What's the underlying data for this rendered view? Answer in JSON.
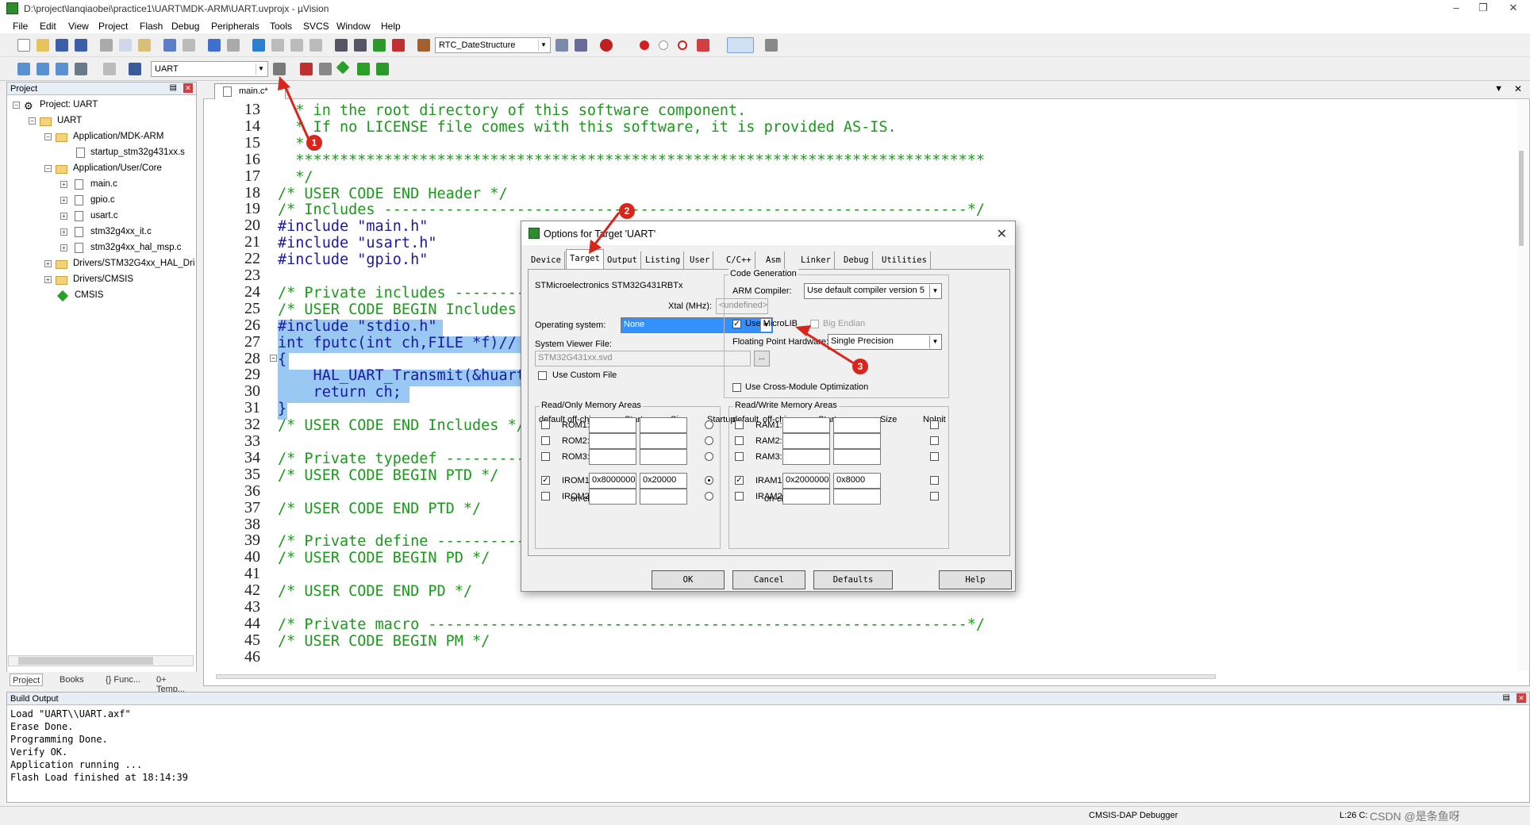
{
  "window": {
    "title": "D:\\project\\lanqiaobei\\practice1\\UART\\MDK-ARM\\UART.uvprojx - µVision"
  },
  "menu": [
    "File",
    "Edit",
    "View",
    "Project",
    "Flash",
    "Debug",
    "Peripherals",
    "Tools",
    "SVCS",
    "Window",
    "Help"
  ],
  "toolbar": {
    "function_combo": "RTC_DateStructure",
    "target_combo": "UART"
  },
  "project_panel": {
    "title": "Project",
    "tree": [
      "Project: UART",
      "UART",
      "Application/MDK-ARM",
      "startup_stm32g431xx.s",
      "Application/User/Core",
      "main.c",
      "gpio.c",
      "usart.c",
      "stm32g4xx_it.c",
      "stm32g4xx_hal_msp.c",
      "Drivers/STM32G4xx_HAL_Dri",
      "Drivers/CMSIS",
      "CMSIS"
    ],
    "tabs": [
      "Project",
      "Books",
      "{} Func...",
      "0+ Temp..."
    ]
  },
  "editor": {
    "tab": "main.c*",
    "lines": [
      {
        "n": "13",
        "t": "  * in the root directory of this software component."
      },
      {
        "n": "14",
        "t": "  * If no LICENSE file comes with this software, it is provided AS-IS."
      },
      {
        "n": "15",
        "t": "  *"
      },
      {
        "n": "16",
        "t": "  ******************************************************************************"
      },
      {
        "n": "17",
        "t": "  */"
      },
      {
        "n": "18",
        "t": "/* USER CODE END Header */"
      },
      {
        "n": "19",
        "t": "/* Includes ------------------------------------------------------------------*/"
      },
      {
        "n": "20",
        "t": "#include \"main.h\""
      },
      {
        "n": "21",
        "t": "#include \"usart.h\""
      },
      {
        "n": "22",
        "t": "#include \"gpio.h\""
      },
      {
        "n": "23",
        "t": ""
      },
      {
        "n": "24",
        "t": "/* Private includes ----------"
      },
      {
        "n": "25",
        "t": "/* USER CODE BEGIN Includes"
      },
      {
        "n": "26",
        "t": "#include \"stdio.h\""
      },
      {
        "n": "27",
        "t": "int fputc(int ch,FILE *f)//"
      },
      {
        "n": "28",
        "t": "{"
      },
      {
        "n": "29",
        "t": "    HAL_UART_Transmit(&huart"
      },
      {
        "n": "30",
        "t": "    return ch;"
      },
      {
        "n": "31",
        "t": "}"
      },
      {
        "n": "32",
        "t": "/* USER CODE END Includes */"
      },
      {
        "n": "33",
        "t": ""
      },
      {
        "n": "34",
        "t": "/* Private typedef ----------"
      },
      {
        "n": "35",
        "t": "/* USER CODE BEGIN PTD */"
      },
      {
        "n": "36",
        "t": ""
      },
      {
        "n": "37",
        "t": "/* USER CODE END PTD */"
      },
      {
        "n": "38",
        "t": ""
      },
      {
        "n": "39",
        "t": "/* Private define -----------"
      },
      {
        "n": "40",
        "t": "/* USER CODE BEGIN PD */"
      },
      {
        "n": "41",
        "t": ""
      },
      {
        "n": "42",
        "t": "/* USER CODE END PD */"
      },
      {
        "n": "43",
        "t": ""
      },
      {
        "n": "44",
        "t": "/* Private macro -------------------------------------------------------------*/"
      },
      {
        "n": "45",
        "t": "/* USER CODE BEGIN PM */"
      },
      {
        "n": "46",
        "t": ""
      }
    ]
  },
  "dialog": {
    "title": "Options for Target 'UART'",
    "tabs": [
      "Device",
      "Target",
      "Output",
      "Listing",
      "User",
      "C/C++",
      "Asm",
      "Linker",
      "Debug",
      "Utilities"
    ],
    "active_tab": "Target",
    "device": "STMicroelectronics STM32G431RBTx",
    "xtal_label": "Xtal (MHz):",
    "xtal_value": "<undefined>",
    "os_label": "Operating system:",
    "os_value": "None",
    "svd_label": "System Viewer File:",
    "svd_value": "STM32G431xx.svd",
    "custom_file": "Use Custom File",
    "codegen_title": "Code Generation",
    "compiler_label": "ARM Compiler:",
    "compiler_value": "Use default compiler version 5",
    "microlib": "Use MicroLIB",
    "big_endian": "Big Endian",
    "fp_label": "Floating Point Hardware:",
    "fp_value": "Single Precision",
    "cross_module": "Use Cross-Module Optimization",
    "ro_title": "Read/Only Memory Areas",
    "rw_title": "Read/Write Memory Areas",
    "col_default": "default",
    "col_offchip": "off-chip",
    "col_start": "Start",
    "col_size": "Size",
    "col_startup": "Startup",
    "col_noinit": "NoInit",
    "onchip": "on-chip",
    "rom_rows": [
      {
        "name": "ROM1:",
        "start": "",
        "size": ""
      },
      {
        "name": "ROM2:",
        "start": "",
        "size": ""
      },
      {
        "name": "ROM3:",
        "start": "",
        "size": ""
      },
      {
        "name": "IROM1:",
        "start": "0x8000000",
        "size": "0x20000"
      },
      {
        "name": "IROM2:",
        "start": "",
        "size": ""
      }
    ],
    "ram_rows": [
      {
        "name": "RAM1:",
        "start": "",
        "size": ""
      },
      {
        "name": "RAM2:",
        "start": "",
        "size": ""
      },
      {
        "name": "RAM3:",
        "start": "",
        "size": ""
      },
      {
        "name": "IRAM1:",
        "start": "0x20000000",
        "size": "0x8000"
      },
      {
        "name": "IRAM2:",
        "start": "",
        "size": ""
      }
    ],
    "buttons": [
      "OK",
      "Cancel",
      "Defaults",
      "Help"
    ]
  },
  "annotations": [
    "1",
    "2",
    "3"
  ],
  "build_output": {
    "title": "Build Output",
    "lines": [
      "Load \"UART\\\\UART.axf\"",
      "Erase Done.",
      "Programming Done.",
      "Verify OK.",
      "Application running ...",
      "Flash Load finished at 18:14:39"
    ]
  },
  "status": {
    "debugger": "CMSIS-DAP Debugger",
    "position": "L:26 C:",
    "watermark": "CSDN @是条鱼呀"
  },
  "colors": {
    "selection": "#99c9f3",
    "comment": "#1a9a1a",
    "directive": "#1a1aa0",
    "annotation": "#d9261c"
  }
}
